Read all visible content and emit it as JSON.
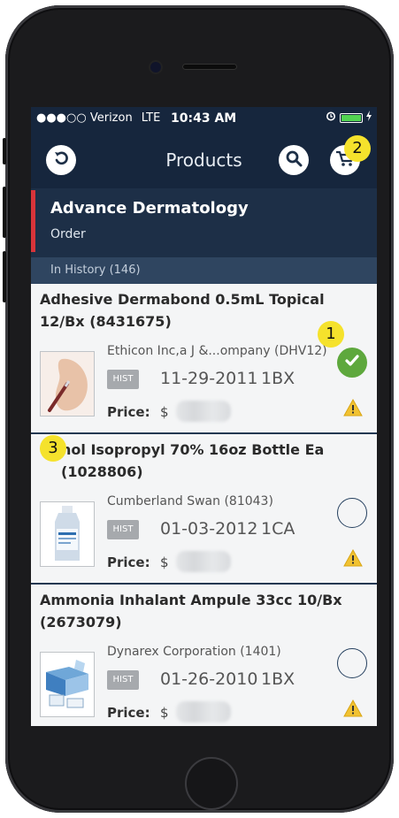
{
  "status_bar": {
    "carrier": "●●●○○ Verizon",
    "network": "LTE",
    "time": "10:43 AM"
  },
  "nav": {
    "title": "Products",
    "icons": [
      "back-icon",
      "search-icon",
      "cart-icon"
    ]
  },
  "account": {
    "name": "Advance Dermatology",
    "subtitle": "Order",
    "accent_color": "#d8343a"
  },
  "history": {
    "label": "In History (146)"
  },
  "products": [
    {
      "name": "Adhesive Dermabond 0.5mL Topical 12/Bx (8431675)",
      "vendor": "Ethicon Inc,a J &...ompany (DHV12)",
      "badge": "HIST",
      "date": "11-29-2011",
      "qty": "1BX",
      "price_label": "Price:",
      "currency": "$",
      "selected": true
    },
    {
      "name": "hol Isopropyl 70% 16oz Bottle Ea (1028806)",
      "vendor": "Cumberland Swan (81043)",
      "badge": "HIST",
      "date": "01-03-2012",
      "qty": "1CA",
      "price_label": "Price:",
      "currency": "$",
      "selected": false
    },
    {
      "name": "Ammonia Inhalant Ampule 33cc 10/Bx (2673079)",
      "vendor": "Dynarex Corporation (1401)",
      "badge": "HIST",
      "date": "01-26-2010",
      "qty": "1BX",
      "price_label": "Price:",
      "currency": "$",
      "selected": false
    }
  ],
  "callouts": [
    "1",
    "2",
    "3"
  ]
}
